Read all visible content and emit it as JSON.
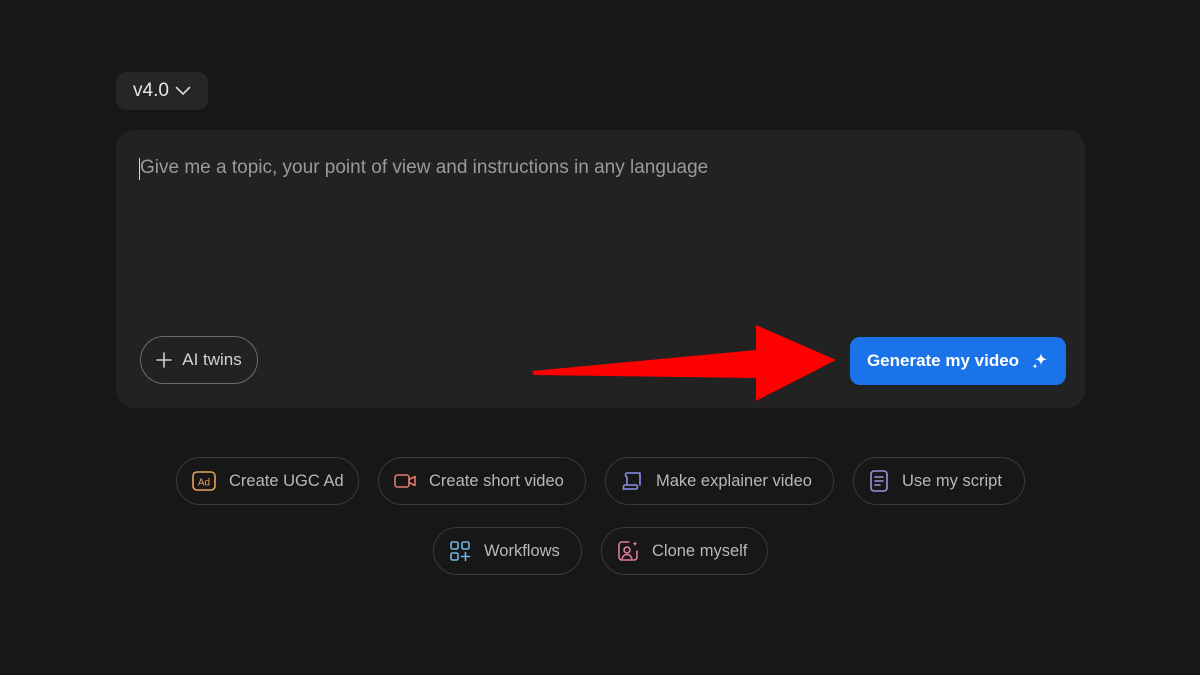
{
  "version_selector": {
    "label": "v4.0",
    "icon": "chevron-down-icon"
  },
  "composer": {
    "placeholder": "Give me a topic, your point of view and instructions in any language",
    "value": "",
    "ai_twins_label": "AI twins",
    "ai_twins_icon": "plus-icon",
    "generate_label": "Generate my video",
    "generate_icon": "sparkle-icon",
    "generate_color": "#1a73e8"
  },
  "annotation": {
    "arrow_color": "#ff0000"
  },
  "quick_actions": [
    {
      "label": "Create UGC Ad",
      "icon": "ad-icon",
      "color": "#e8a25c"
    },
    {
      "label": "Create short video",
      "icon": "video-camera-icon",
      "color": "#e07a6a"
    },
    {
      "label": "Make explainer video",
      "icon": "scroll-icon",
      "color": "#8c8fe8"
    },
    {
      "label": "Use my script",
      "icon": "document-icon",
      "color": "#9a94e0"
    },
    {
      "label": "Workflows",
      "icon": "grid-plus-icon",
      "color": "#6fb6e0"
    },
    {
      "label": "Clone myself",
      "icon": "user-sparkle-icon",
      "color": "#e07aa0"
    }
  ]
}
